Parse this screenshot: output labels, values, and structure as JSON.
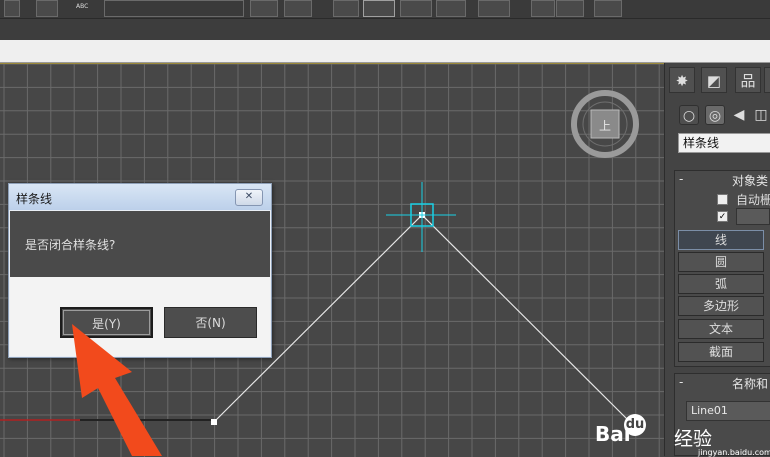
{
  "toolbar": {
    "abc_label": "ABC"
  },
  "viewport": {
    "name": "Top",
    "gizmo_label": "上"
  },
  "dialog": {
    "title": "样条线",
    "close_glyph": "✕",
    "message": "是否闭合样条线?",
    "yes_label": "是(Y)",
    "no_label": "否(N)"
  },
  "panel": {
    "type_dropdown": "样条线",
    "object_type_rollout": {
      "title": "对象类",
      "auto_grid_label": "自动栅",
      "start_new_shape_checked": true,
      "buttons": [
        "线",
        "圆",
        "弧",
        "多边形",
        "文本",
        "截面"
      ]
    },
    "name_rollout": {
      "title": "名称和",
      "name_value": "Line01"
    }
  },
  "watermark": {
    "brand_left": "Bai",
    "brand_paw": "du",
    "brand_right": "经验",
    "url": "jingyan.baidu.com"
  },
  "colors": {
    "grid": "#6a6a6a",
    "spline": "#e6e6e6",
    "cursor": "#19d0e6",
    "arrow": "#f24a1c",
    "axis_red": "#b02020"
  }
}
